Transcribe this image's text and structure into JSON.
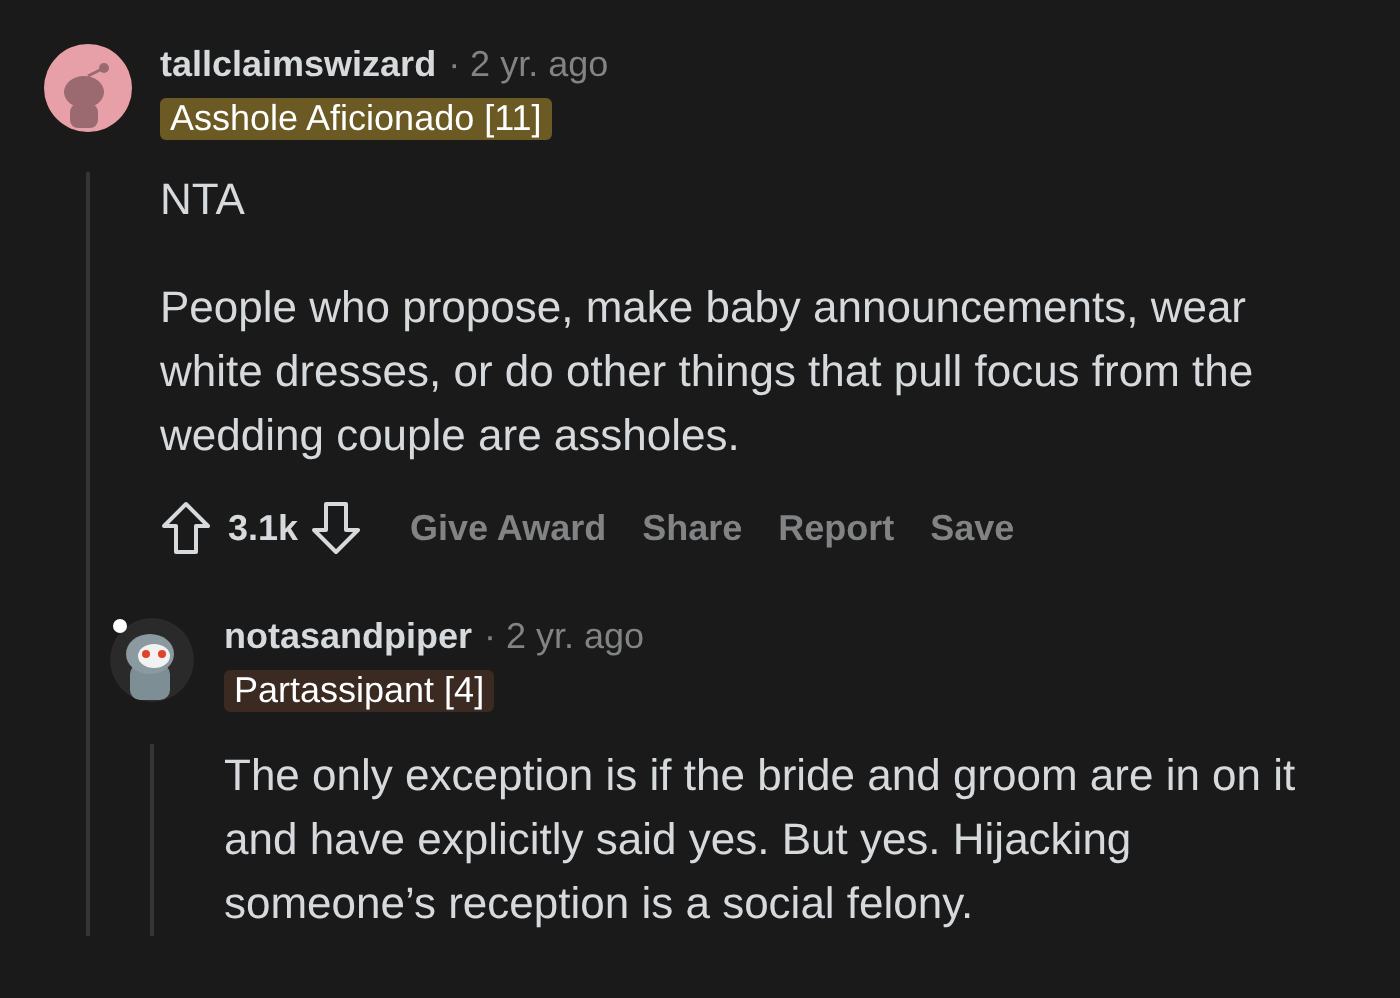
{
  "comments": [
    {
      "author": "tallclaimswizard",
      "time": "· 2 yr. ago",
      "flair": {
        "text": "Asshole Aficionado [11]",
        "color": "#6b5a24"
      },
      "paragraphs": [
        "NTA",
        "People who propose, make baby announcements, wear white dresses, or do other things that pull focus from the wedding couple are assholes."
      ],
      "votes": "3.1k",
      "actions": [
        "Give Award",
        "Share",
        "Report",
        "Save"
      ],
      "children": [
        {
          "author": "notasandpiper",
          "time": "· 2 yr. ago",
          "flair": {
            "text": "Partassipant [4]",
            "color": "#3a2a22"
          },
          "paragraphs": [
            "The only exception is if the bride and groom are in on it and have explicitly said yes. But yes. Hijacking someone’s reception is a social felony."
          ]
        }
      ]
    }
  ]
}
